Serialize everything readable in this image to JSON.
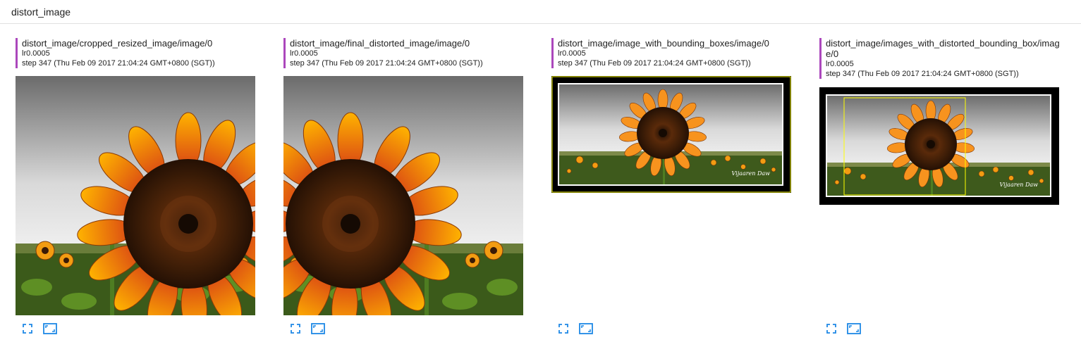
{
  "header": {
    "title": "distort_image"
  },
  "cards": [
    {
      "tag": "distort_image/cropped_resized_image/image/0",
      "run": "lr0.0005",
      "step": "step 347 (Thu Feb 09 2017 21:04:24 GMT+0800 (SGT))"
    },
    {
      "tag": "distort_image/final_distorted_image/image/0",
      "run": "lr0.0005",
      "step": "step 347 (Thu Feb 09 2017 21:04:24 GMT+0800 (SGT))"
    },
    {
      "tag": "distort_image/image_with_bounding_boxes/image/0",
      "run": "lr0.0005",
      "step": "step 347 (Thu Feb 09 2017 21:04:24 GMT+0800 (SGT))"
    },
    {
      "tag": "distort_image/images_with_distorted_bounding_box/image/0",
      "run": "lr0.0005",
      "step": "step 347 (Thu Feb 09 2017 21:04:24 GMT+0800 (SGT))"
    }
  ],
  "watermark": "Vijaaren Daw",
  "icons": {
    "expand": "fullscreen-icon",
    "actual_size": "actual-size-icon"
  },
  "colors": {
    "accent": "#ab47bc",
    "icon": "#1e88e5",
    "box": "#ffff00"
  }
}
